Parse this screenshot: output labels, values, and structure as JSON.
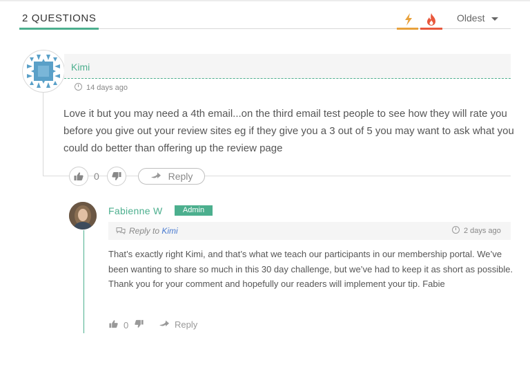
{
  "header": {
    "title": "2 QUESTIONS",
    "sort_hot_icon": "bolt-icon",
    "sort_new_icon": "flame-icon",
    "sort_value": "Oldest",
    "colors": {
      "accent": "#4caf8e",
      "hot": "#e8a13b",
      "new": "#e8573b"
    }
  },
  "comments": [
    {
      "author": "Kimi",
      "date": "14 days ago",
      "body": "Love it but you may need a 4th email...on the third email test people to see how they will rate you before you give out your review sites eg if they give you a 3 out of 5 you may want to ask what you could do better than offering up the review page",
      "votes": "0",
      "reply_label": "Reply"
    },
    {
      "author": "Fabienne W",
      "badge": "Admin",
      "reply_to_prefix": "Reply to",
      "reply_to_name": "Kimi",
      "date": "2 days ago",
      "body": "That’s exactly right Kimi, and that’s what we teach our participants in our membership portal. We’ve been wanting to share so much in this 30 day challenge, but we’ve had to keep it as short as possible. Thank you for your comment and hopefully our readers will implement your tip. Fabie",
      "votes": "0",
      "reply_label": "Reply"
    }
  ]
}
